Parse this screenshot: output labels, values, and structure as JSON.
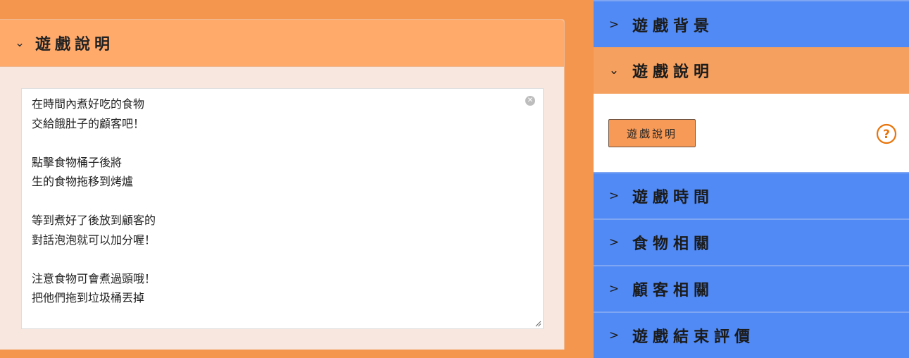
{
  "left_panel": {
    "chevron": "⌄",
    "title": "遊戲說明",
    "textarea_value": "在時間內煮好吃的食物\n交給餓肚子的顧客吧！\n\n點擊食物桶子後將\n生的食物拖移到烤爐\n\n等到煮好了後放到顧客的\n對話泡泡就可以加分喔！\n\n注意食物可會煮過頭哦！\n把他們拖到垃圾桶丟掉",
    "clear_icon": "close-circle-icon"
  },
  "sidebar": {
    "items": [
      {
        "label": "遊戲背景",
        "chevron": ">"
      },
      {
        "label": "遊戲說明",
        "chevron": "⌄",
        "expanded": true
      },
      {
        "label": "遊戲時間",
        "chevron": ">"
      },
      {
        "label": "食物相關",
        "chevron": ">"
      },
      {
        "label": "顧客相關",
        "chevron": ">"
      },
      {
        "label": "遊戲結束評價",
        "chevron": ">"
      }
    ],
    "expanded_body": {
      "button_label": "遊戲說明",
      "help_icon": "question-circle-icon"
    }
  },
  "colors": {
    "background": "#F5964F",
    "sidebar_blue": "#518AF5",
    "active_orange": "#F5A05F",
    "panel_header": "#FFAA6B",
    "panel_body": "#F7E7DE",
    "help_icon": "#E8750C"
  }
}
